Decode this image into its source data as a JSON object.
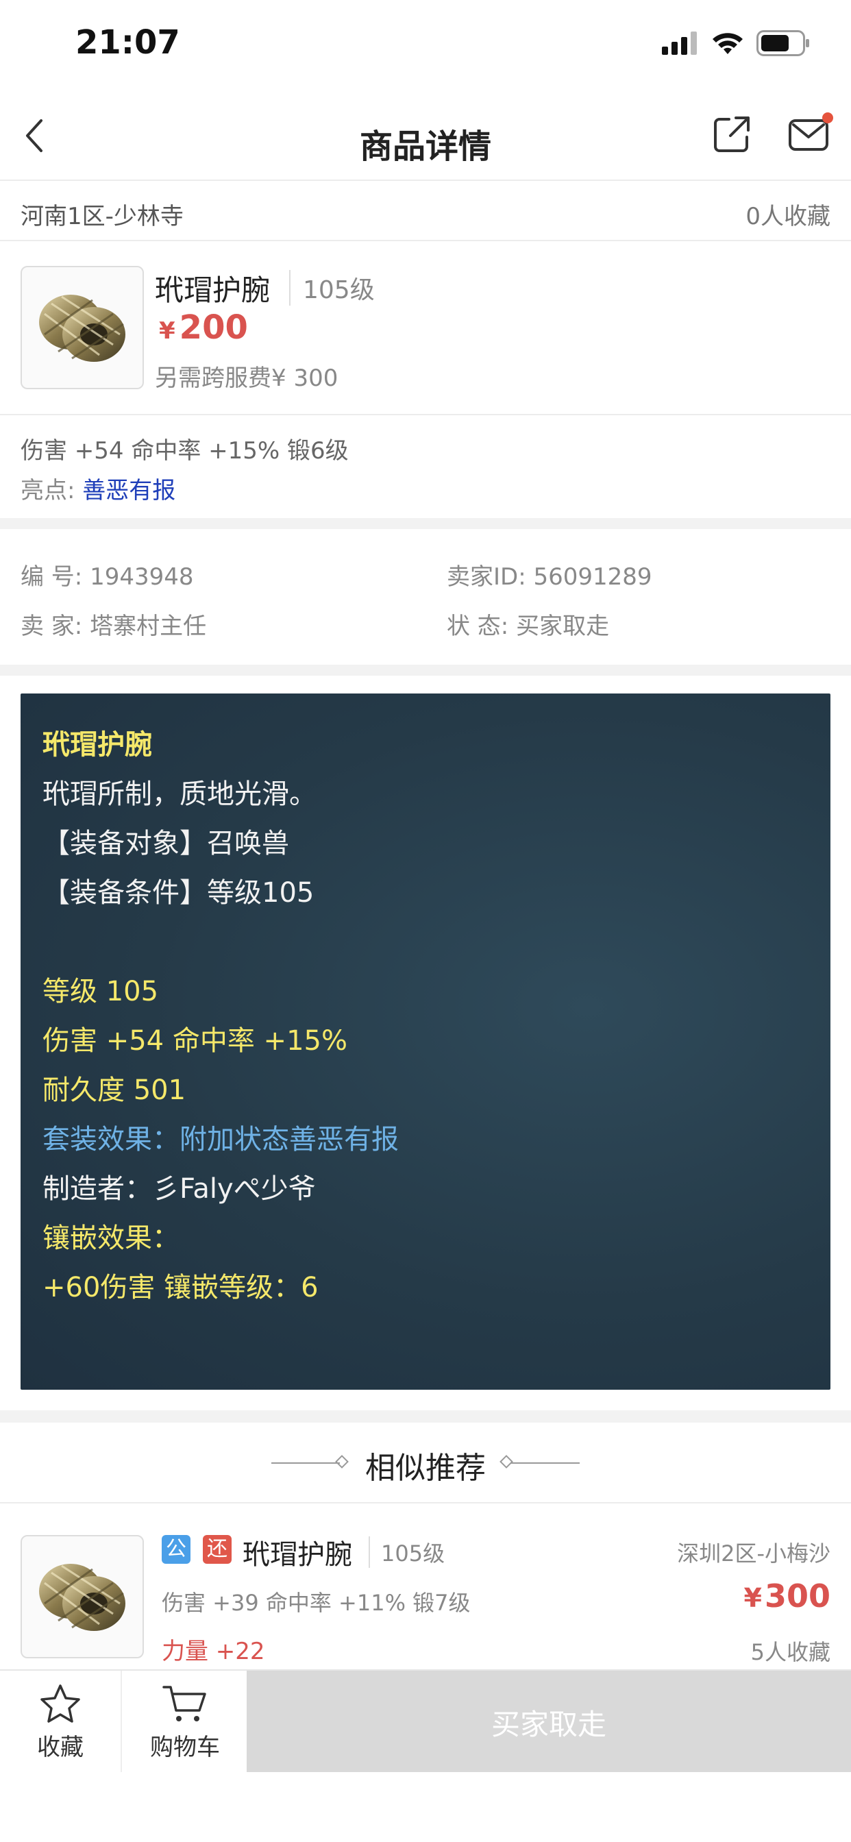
{
  "status_bar": {
    "time": "21:07"
  },
  "nav": {
    "title": "商品详情"
  },
  "server_row": {
    "server": "河南1区-少林寺",
    "favorites": "0人收藏"
  },
  "item": {
    "name": "玳瑁护腕",
    "level": "105级",
    "price_symbol": "¥",
    "price": "200",
    "cross_fee": "另需跨服费¥ 300"
  },
  "attributes": {
    "line": "伤害 +54 命中率 +15% 锻6级",
    "highlight_label": "亮点:",
    "highlight_value": "善恶有报"
  },
  "info": {
    "id_label": "编 号:",
    "id_value": "1943948",
    "seller_id_label": "卖家ID:",
    "seller_id_value": "56091289",
    "seller_label": "卖 家:",
    "seller_value": "塔寨村主任",
    "status_label": "状 态:",
    "status_value": "买家取走"
  },
  "description": {
    "title": "玳瑁护腕",
    "flavor": "玳瑁所制，质地光滑。",
    "equip_target": "【装备对象】召唤兽",
    "equip_condition": "【装备条件】等级105",
    "level": "等级 105",
    "stats": "伤害 +54 命中率 +15%",
    "durability": "耐久度 501",
    "set_effect": "套装效果：附加状态善恶有报",
    "maker": "制造者：彡Falyぺ少爷",
    "inlay_label": "镶嵌效果：",
    "inlay_value": "+60伤害 镶嵌等级：6"
  },
  "similar": {
    "title": "相似推荐"
  },
  "recommendation": {
    "badge_public": "公",
    "badge_return": "还",
    "name": "玳瑁护腕",
    "level": "105级",
    "server": "深圳2区-小梅沙",
    "attributes": "伤害 +39 命中率 +11% 锻7级",
    "price_symbol": "¥",
    "price": "300",
    "extra": "力量 +22",
    "favorites": "5人收藏"
  },
  "bottom_bar": {
    "favorite_label": "收藏",
    "cart_label": "购物车",
    "buy_label": "买家取走"
  },
  "colors": {
    "price_red": "#d9534f",
    "panel_bg": "#253a48",
    "yellow_text": "#f5e86a",
    "blue_text": "#6fb2e6",
    "highlight_blue": "#1f3fb9"
  }
}
